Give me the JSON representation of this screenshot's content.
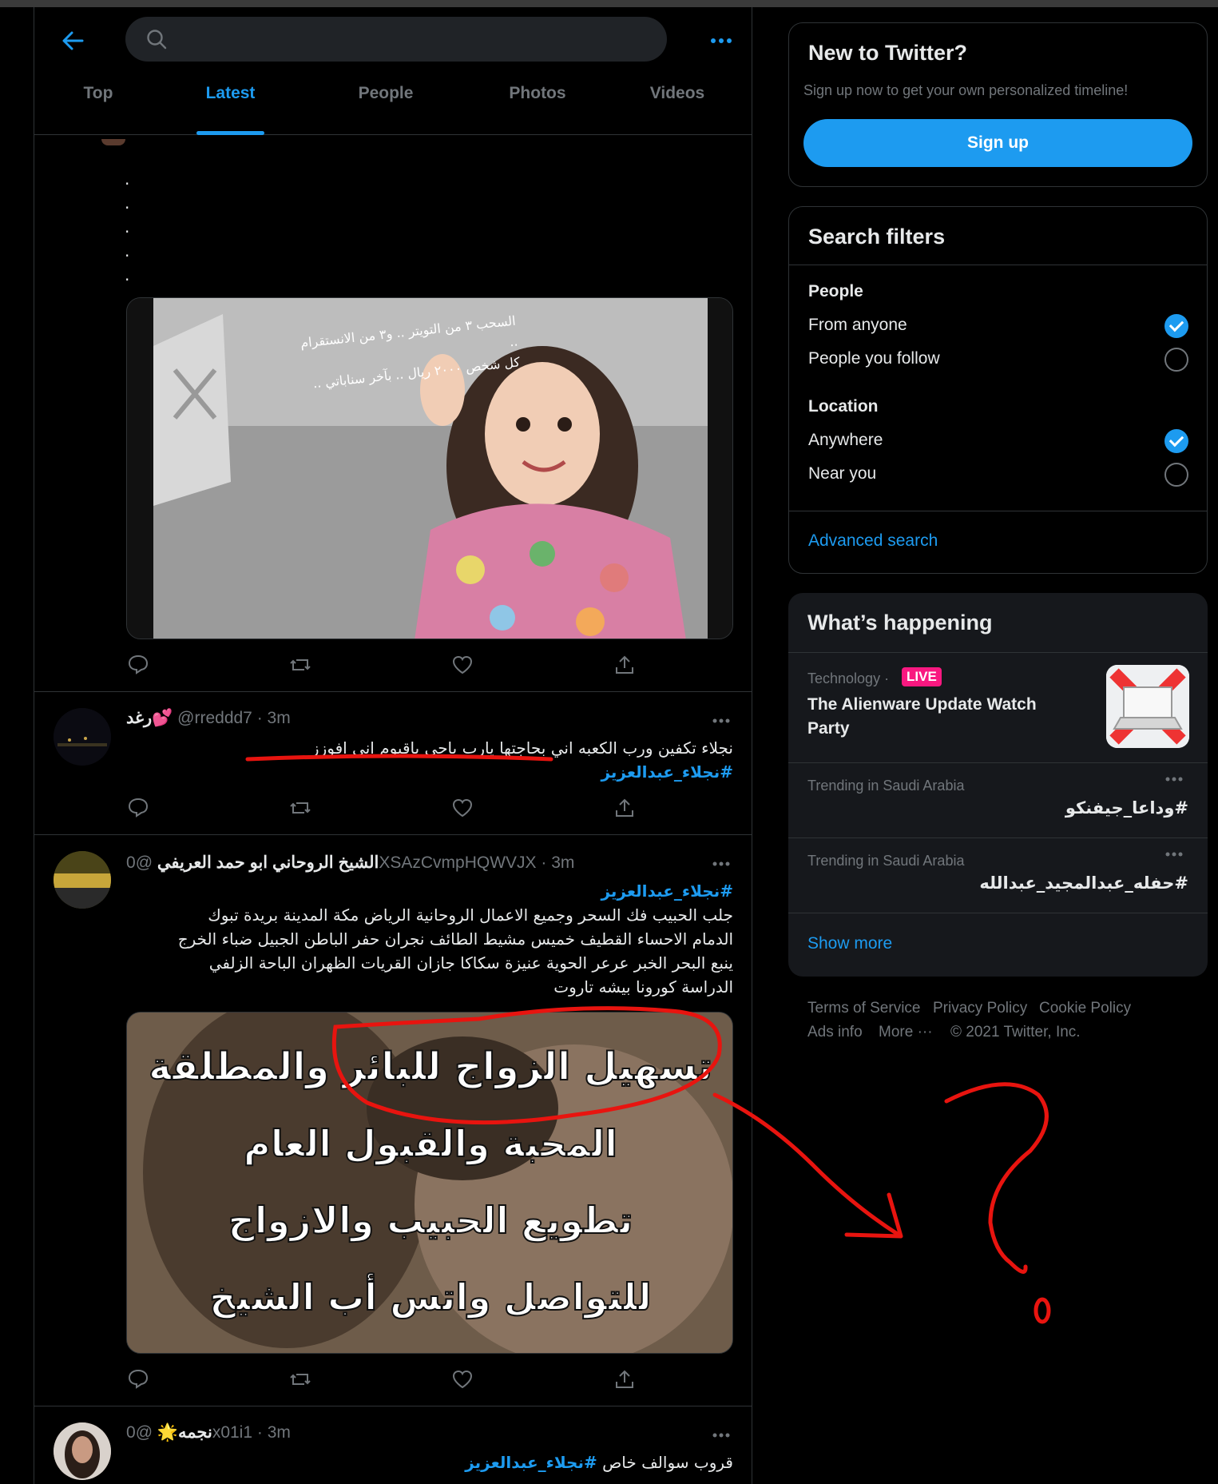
{
  "search": {
    "placeholder": "",
    "value": ""
  },
  "tabs": [
    {
      "label": "Top",
      "active": false
    },
    {
      "label": "Latest",
      "active": true
    },
    {
      "label": "People",
      "active": false
    },
    {
      "label": "Photos",
      "active": false
    },
    {
      "label": "Videos",
      "active": false
    }
  ],
  "tweets": [
    {
      "leading_dots": [
        ".",
        ".",
        ".",
        ".",
        "."
      ],
      "image_overlay_lines": [
        "السحب ٣ من التويتر .. و٣ من الانستقرام ..",
        "كل شخص ٢٠٠٠ ريال .. بآخر سناباتي .."
      ]
    },
    {
      "name": "رغد💕",
      "handle": "@rreddd7",
      "time": "3m",
      "text": "نجلاء تكفين ورب الكعبه اني بحاجتها يارب ياحي ياقيوم اني افوزز",
      "hashtag": "#نجلاء_عبدالعزيز"
    },
    {
      "name": "الشيخ الروحاني ابو حمد العريفي",
      "handle": "@0XSAzCvmpHQWVJX",
      "time": "3m",
      "hashtag": "#نجلاء_عبدالعزيز",
      "text_lines": [
        "جلب الحبيب فك السحر وجميع الاعمال الروحانية الرياض مكة المدينة بريدة تبوك",
        "الدمام الاحساء القطيف خميس مشيط الطائف نجران حفر الباطن الجبيل ضباء الخرج",
        "ينبع البحر الخبر عرعر الحوية عنيزة سكاكا جازان القريات الظهران الباحة الزلفي",
        "الدراسة كورونا بيشه تاروت"
      ],
      "image_lines": [
        "تسهيل الزواج للبائر والمطلقة",
        "المحبة والقبول العام",
        "تطويع الحبيب والازواج",
        "للتواصل واتس أب الشيخ"
      ]
    },
    {
      "name": "نجمه🌟",
      "handle": "@0x01i1",
      "time": "3m",
      "text": "قروب سوالف خاص",
      "hashtag": "#نجلاء_عبدالعزيز"
    }
  ],
  "signup_card": {
    "title": "New to Twitter?",
    "subtitle": "Sign up now to get your own personalized timeline!",
    "button": "Sign up"
  },
  "filters": {
    "title": "Search filters",
    "people_heading": "People",
    "from_anyone": "From anyone",
    "people_you_follow": "People you follow",
    "location_heading": "Location",
    "anywhere": "Anywhere",
    "near_you": "Near you",
    "advanced": "Advanced search"
  },
  "happening": {
    "title": "What’s happening",
    "items": [
      {
        "context": "Technology ·",
        "badge": "LIVE",
        "title": "The Alienware Update Watch Party"
      },
      {
        "context": "Trending in Saudi Arabia",
        "title": "#وداعا_جيفنكو"
      },
      {
        "context": "Trending in Saudi Arabia",
        "title": "#حفله_عبدالمجيد_عبدالله"
      }
    ],
    "show_more": "Show more"
  },
  "footer": {
    "terms": "Terms of Service",
    "privacy": "Privacy Policy",
    "cookie": "Cookie Policy",
    "ads": "Ads info",
    "more": "More ···",
    "copyright": "© 2021 Twitter, Inc."
  },
  "annotation": {
    "mark": "?"
  },
  "colors": {
    "accent": "#1d9bf0",
    "annotation": "#e8140f",
    "live": "#f91880"
  }
}
